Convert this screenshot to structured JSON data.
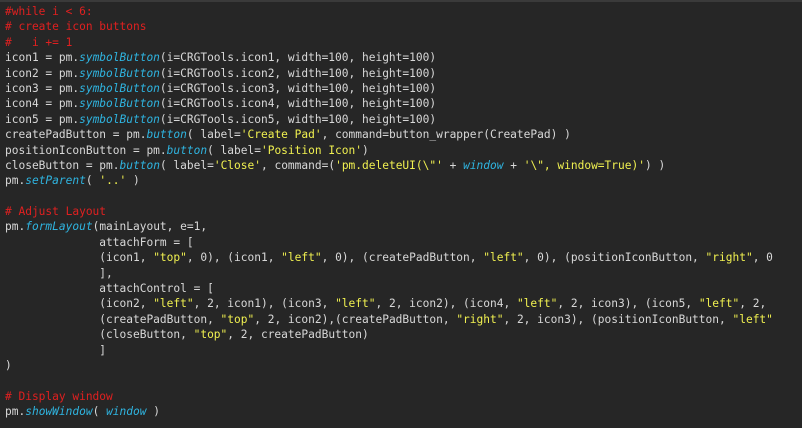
{
  "theme": {
    "background": "#262626",
    "plain": "#d8d8d8",
    "comment": "#e02020",
    "function": "#2fb4e0",
    "string": "#f0f050"
  },
  "lines": [
    [
      {
        "t": "comment",
        "v": "#while i < 6:"
      }
    ],
    [
      {
        "t": "comment",
        "v": "# create icon buttons"
      }
    ],
    [
      {
        "t": "comment",
        "v": "#   i += 1"
      }
    ],
    [
      {
        "t": "plain",
        "v": "icon1 = pm."
      },
      {
        "t": "func",
        "v": "symbolButton"
      },
      {
        "t": "plain",
        "v": "(i=CRGTools.icon1, width=100, height=100)"
      }
    ],
    [
      {
        "t": "plain",
        "v": "icon2 = pm."
      },
      {
        "t": "func",
        "v": "symbolButton"
      },
      {
        "t": "plain",
        "v": "(i=CRGTools.icon2, width=100, height=100)"
      }
    ],
    [
      {
        "t": "plain",
        "v": "icon3 = pm."
      },
      {
        "t": "func",
        "v": "symbolButton"
      },
      {
        "t": "plain",
        "v": "(i=CRGTools.icon3, width=100, height=100)"
      }
    ],
    [
      {
        "t": "plain",
        "v": "icon4 = pm."
      },
      {
        "t": "func",
        "v": "symbolButton"
      },
      {
        "t": "plain",
        "v": "(i=CRGTools.icon4, width=100, height=100)"
      }
    ],
    [
      {
        "t": "plain",
        "v": "icon5 = pm."
      },
      {
        "t": "func",
        "v": "symbolButton"
      },
      {
        "t": "plain",
        "v": "(i=CRGTools.icon5, width=100, height=100)"
      }
    ],
    [
      {
        "t": "plain",
        "v": "createPadButton = pm."
      },
      {
        "t": "func",
        "v": "button"
      },
      {
        "t": "plain",
        "v": "( label="
      },
      {
        "t": "string",
        "v": "'Create Pad'"
      },
      {
        "t": "plain",
        "v": ", command=button_wrapper(CreatePad) )"
      }
    ],
    [
      {
        "t": "plain",
        "v": "positionIconButton = pm."
      },
      {
        "t": "func",
        "v": "button"
      },
      {
        "t": "plain",
        "v": "( label="
      },
      {
        "t": "string",
        "v": "'Position Icon'"
      },
      {
        "t": "plain",
        "v": ")"
      }
    ],
    [
      {
        "t": "plain",
        "v": "closeButton = pm."
      },
      {
        "t": "func",
        "v": "button"
      },
      {
        "t": "plain",
        "v": "( label="
      },
      {
        "t": "string",
        "v": "'Close'"
      },
      {
        "t": "plain",
        "v": ", command=("
      },
      {
        "t": "string",
        "v": "'pm.deleteUI(\\\"'"
      },
      {
        "t": "plain",
        "v": " + "
      },
      {
        "t": "func",
        "v": "window"
      },
      {
        "t": "plain",
        "v": " + "
      },
      {
        "t": "string",
        "v": "'\\\", window=True)'"
      },
      {
        "t": "plain",
        "v": ") )"
      }
    ],
    [
      {
        "t": "plain",
        "v": "pm."
      },
      {
        "t": "func",
        "v": "setParent"
      },
      {
        "t": "plain",
        "v": "( "
      },
      {
        "t": "string",
        "v": "'..'"
      },
      {
        "t": "plain",
        "v": " )"
      }
    ],
    [
      {
        "t": "plain",
        "v": ""
      }
    ],
    [
      {
        "t": "comment",
        "v": "# Adjust Layout"
      }
    ],
    [
      {
        "t": "plain",
        "v": "pm."
      },
      {
        "t": "func",
        "v": "formLayout"
      },
      {
        "t": "plain",
        "v": "(mainLayout, e=1,"
      }
    ],
    [
      {
        "t": "plain",
        "v": "              attachForm = ["
      }
    ],
    [
      {
        "t": "plain",
        "v": "              (icon1, "
      },
      {
        "t": "string",
        "v": "\"top\""
      },
      {
        "t": "plain",
        "v": ", 0), (icon1, "
      },
      {
        "t": "string",
        "v": "\"left\""
      },
      {
        "t": "plain",
        "v": ", 0), (createPadButton, "
      },
      {
        "t": "string",
        "v": "\"left\""
      },
      {
        "t": "plain",
        "v": ", 0), (positionIconButton, "
      },
      {
        "t": "string",
        "v": "\"right\""
      },
      {
        "t": "plain",
        "v": ", 0"
      }
    ],
    [
      {
        "t": "plain",
        "v": "              ],"
      }
    ],
    [
      {
        "t": "plain",
        "v": "              attachControl = ["
      }
    ],
    [
      {
        "t": "plain",
        "v": "              (icon2, "
      },
      {
        "t": "string",
        "v": "\"left\""
      },
      {
        "t": "plain",
        "v": ", 2, icon1), (icon3, "
      },
      {
        "t": "string",
        "v": "\"left\""
      },
      {
        "t": "plain",
        "v": ", 2, icon2), (icon4, "
      },
      {
        "t": "string",
        "v": "\"left\""
      },
      {
        "t": "plain",
        "v": ", 2, icon3), (icon5, "
      },
      {
        "t": "string",
        "v": "\"left\""
      },
      {
        "t": "plain",
        "v": ", 2,"
      }
    ],
    [
      {
        "t": "plain",
        "v": "              (createPadButton, "
      },
      {
        "t": "string",
        "v": "\"top\""
      },
      {
        "t": "plain",
        "v": ", 2, icon2),(createPadButton, "
      },
      {
        "t": "string",
        "v": "\"right\""
      },
      {
        "t": "plain",
        "v": ", 2, icon3), (positionIconButton, "
      },
      {
        "t": "string",
        "v": "\"left\""
      }
    ],
    [
      {
        "t": "plain",
        "v": "              (closeButton, "
      },
      {
        "t": "string",
        "v": "\"top\""
      },
      {
        "t": "plain",
        "v": ", 2, createPadButton)"
      }
    ],
    [
      {
        "t": "plain",
        "v": "              ]"
      }
    ],
    [
      {
        "t": "plain",
        "v": ")"
      }
    ],
    [
      {
        "t": "plain",
        "v": ""
      }
    ],
    [
      {
        "t": "comment",
        "v": "# Display window"
      }
    ],
    [
      {
        "t": "plain",
        "v": "pm."
      },
      {
        "t": "func",
        "v": "showWindow"
      },
      {
        "t": "plain",
        "v": "( "
      },
      {
        "t": "func",
        "v": "window"
      },
      {
        "t": "plain",
        "v": " )"
      }
    ]
  ]
}
